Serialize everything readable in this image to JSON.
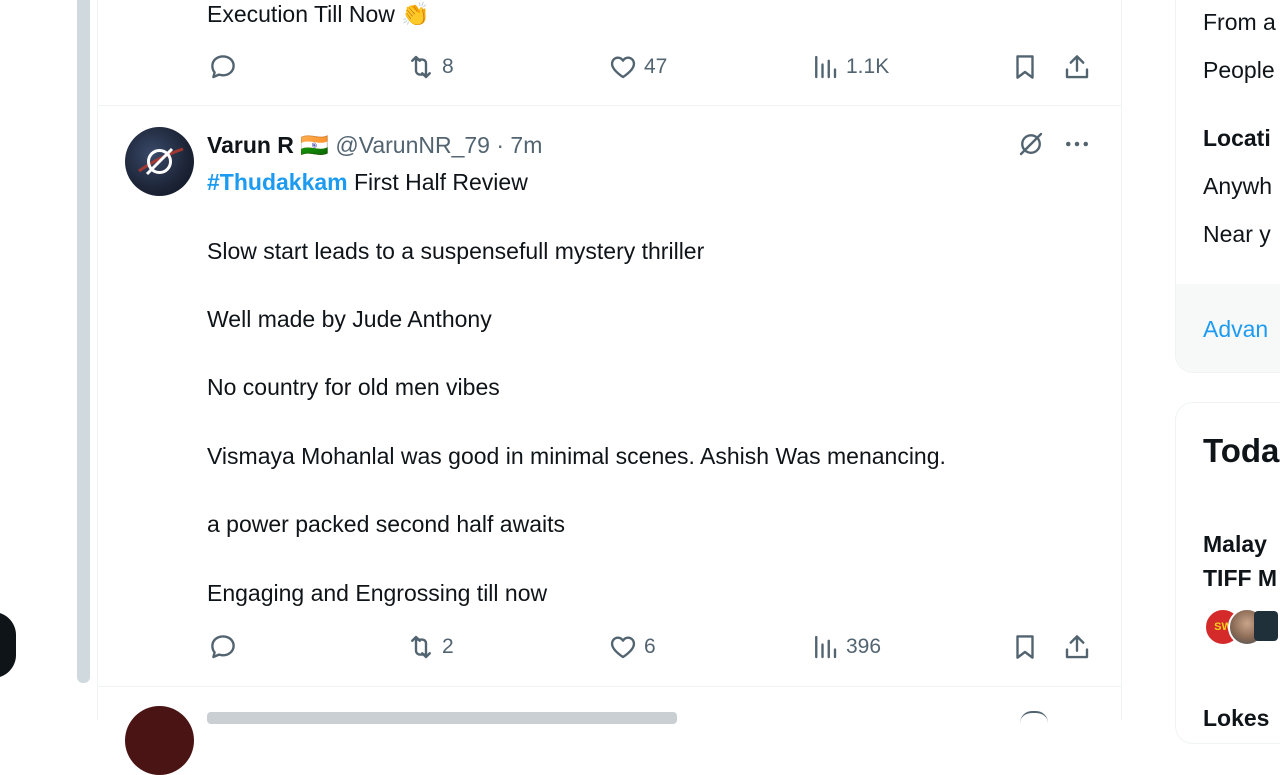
{
  "prev_tweet": {
    "text_line": "Execution Till Now 👏",
    "actions": {
      "replies": "",
      "retweets": "8",
      "likes": "47",
      "views": "1.1K"
    }
  },
  "tweet": {
    "author_name": "Varun R",
    "flag": "🇮🇳",
    "handle": "@VarunNR_79",
    "separator": "·",
    "time": "7m",
    "hashtag": "#Thudakkam",
    "headline_rest": " First Half Review",
    "lines": [
      "Slow start leads to a suspensefull mystery thriller",
      "Well made by Jude Anthony",
      "No country for old men vibes",
      "Vismaya Mohanlal was good in minimal scenes. Ashish Was menancing.",
      "a power packed second half awaits",
      "Engaging and Engrossing till now"
    ],
    "actions": {
      "retweets": "2",
      "likes": "6",
      "views": "396"
    }
  },
  "sidebar": {
    "filters": [
      "From a",
      "People"
    ],
    "location_heading": "Locati",
    "location_options": [
      "Anywh",
      "Near y"
    ],
    "advanced_link": "Advan",
    "trends_heading": "Toda",
    "trend_lines": [
      "Malay",
      "TIFF M"
    ],
    "avatar_badge": "SW",
    "next_item": "Lokes"
  },
  "colors": {
    "accent": "#1d9bf0",
    "muted": "#536471",
    "text": "#0f1419",
    "border": "#eff3f4"
  }
}
